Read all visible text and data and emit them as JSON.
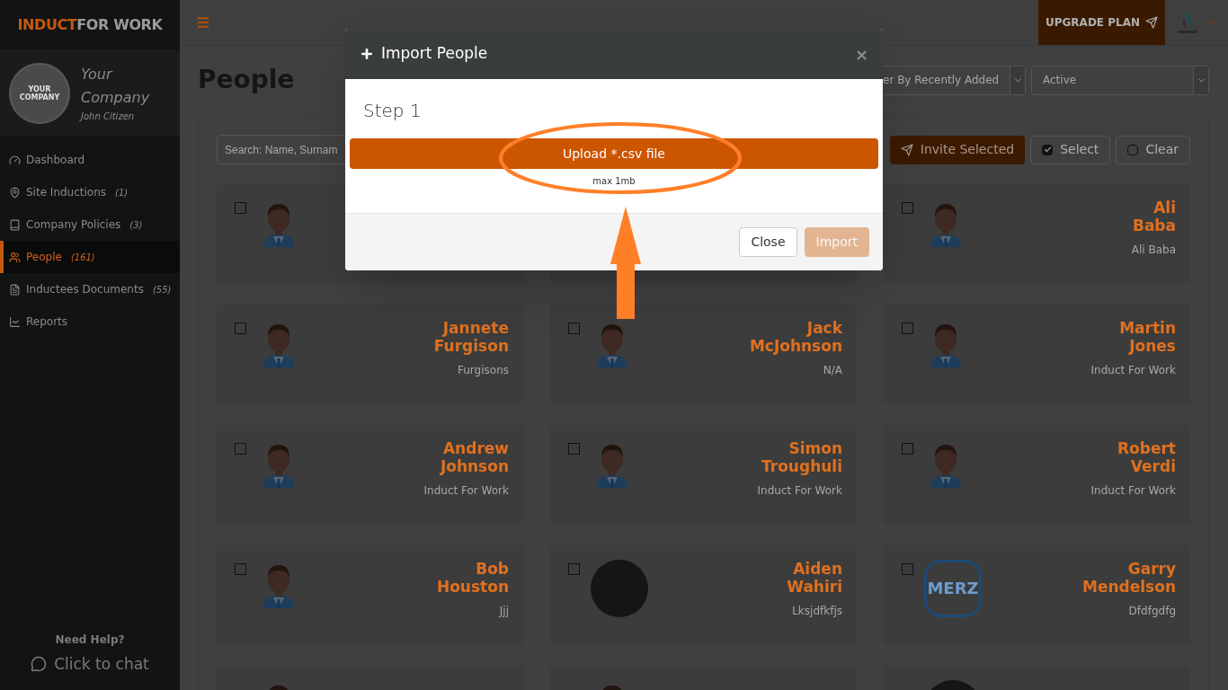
{
  "brand": {
    "part1": "INDUCT",
    "part2": "FOR WORK"
  },
  "profile": {
    "logo_text": "YOUR COMPANY",
    "company": "Your Company",
    "user": "John Citizen"
  },
  "nav": [
    {
      "kind": "dashboard",
      "label": "Dashboard",
      "selected": false
    },
    {
      "kind": "pin",
      "label": "Site Inductions",
      "count": "(1)",
      "selected": false
    },
    {
      "kind": "book",
      "label": "Company Policies",
      "count": "(3)",
      "selected": false
    },
    {
      "kind": "people",
      "label": "People",
      "count": "(161)",
      "selected": true
    },
    {
      "kind": "document",
      "label": "Inductees Documents",
      "count": "(55)",
      "selected": false
    },
    {
      "kind": "chart",
      "label": "Reports",
      "selected": false
    }
  ],
  "help": {
    "title": "Need Help?",
    "link": "Click to chat"
  },
  "topbar": {
    "upgrade": "UPGRADE PLAN"
  },
  "page": {
    "title": "People",
    "sort": "er By Recently Added",
    "status": "Active",
    "search_placeholder": "Search: Name, Surnam",
    "actions": [
      {
        "kind": "invite",
        "label": "Invite Selected"
      },
      {
        "kind": "select",
        "label": "Select"
      },
      {
        "kind": "clear",
        "label": "Clear"
      }
    ]
  },
  "people": [
    {
      "kind": "silhouette",
      "checked": false
    },
    {
      "kind": "hidden"
    },
    {
      "kind": "silhouette",
      "checked": false,
      "first": "Ali",
      "last": "Baba",
      "company": "Ali Baba"
    },
    {
      "kind": "silhouette",
      "checked": false,
      "first": "Jannete",
      "last": "Furgison",
      "company": "Furgisons"
    },
    {
      "kind": "silhouette",
      "checked": false,
      "first": "Jack",
      "last": "McJohnson",
      "company": "N/A"
    },
    {
      "kind": "silhouette",
      "checked": false,
      "first": "Martin",
      "last": "Jones",
      "company": "Induct For Work"
    },
    {
      "kind": "silhouette",
      "checked": false,
      "first": "Andrew",
      "last": "Johnson",
      "company": "Induct For Work"
    },
    {
      "kind": "silhouette",
      "checked": false,
      "first": "Simon",
      "last": "Troughuli",
      "company": "Induct For Work"
    },
    {
      "kind": "silhouette",
      "checked": false,
      "first": "Robert",
      "last": "Verdi",
      "company": "Induct For Work"
    },
    {
      "kind": "silhouette",
      "checked": false,
      "first": "Bob",
      "last": "Houston",
      "company": "Jjj"
    },
    {
      "kind": "photo",
      "checked": false,
      "first": "Aiden",
      "last": "Wahiri",
      "company": "Lksjdfkfjs"
    },
    {
      "kind": "logo",
      "logo_text": "MERZ",
      "checked": false,
      "first": "Garry",
      "last": "Mendelson",
      "company": "Dfdfgdfg"
    },
    {
      "kind": "silhouette"
    },
    {
      "kind": "silhouette"
    },
    {
      "kind": "photo"
    }
  ],
  "modal": {
    "title": "Import People",
    "close": "×",
    "step": "Step 1",
    "upload": "Upload *.csv file",
    "hint": "max 1mb",
    "buttons": [
      {
        "kind": "default",
        "label": "Close",
        "disabled": false
      },
      {
        "kind": "primary",
        "label": "Import",
        "disabled": true
      }
    ]
  }
}
